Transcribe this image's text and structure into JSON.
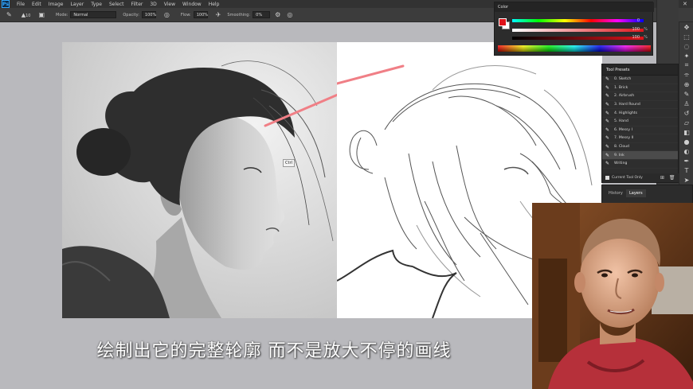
{
  "app": {
    "logo": "Ps"
  },
  "menu": [
    "File",
    "Edit",
    "Image",
    "Layer",
    "Type",
    "Select",
    "Filter",
    "3D",
    "View",
    "Window",
    "Help"
  ],
  "window_controls": {
    "minimize": "—",
    "maximize": "▫",
    "close": "✕"
  },
  "options_bar": {
    "brush_size": "10",
    "mode_label": "Mode:",
    "mode_value": "Normal",
    "opacity_label": "Opacity:",
    "opacity_value": "100%",
    "flow_label": "Flow:",
    "flow_value": "100%",
    "smoothing_label": "Smoothing:",
    "smoothing_value": "0%"
  },
  "color_panel": {
    "tab": "Color",
    "r_value": "0",
    "g_value": "100",
    "b_value": "100",
    "pct": "%",
    "fg_color": "#e0141b"
  },
  "tooltip": "Ctrl",
  "tool_presets": {
    "title": "Tool Presets",
    "items": [
      {
        "label": "0. Sketch"
      },
      {
        "label": "1. Brick"
      },
      {
        "label": "2. Airbrush"
      },
      {
        "label": "3. Hard Round"
      },
      {
        "label": "4. Highlights"
      },
      {
        "label": "5. Hand"
      },
      {
        "label": "6. Messy I"
      },
      {
        "label": "7. Messy II"
      },
      {
        "label": "8. Cloud"
      },
      {
        "label": "9. Ink"
      },
      {
        "label": "Writing"
      }
    ],
    "selected_index": 9,
    "footer": "Current Tool Only"
  },
  "layers_panel": {
    "tab_history": "History",
    "tab_layers": "Layers"
  },
  "subtitle": "绘制出它的完整轮廓 而不是放大不停的画线",
  "colors": {
    "accent": "#31a8ff",
    "stroke": "#f07f86"
  }
}
